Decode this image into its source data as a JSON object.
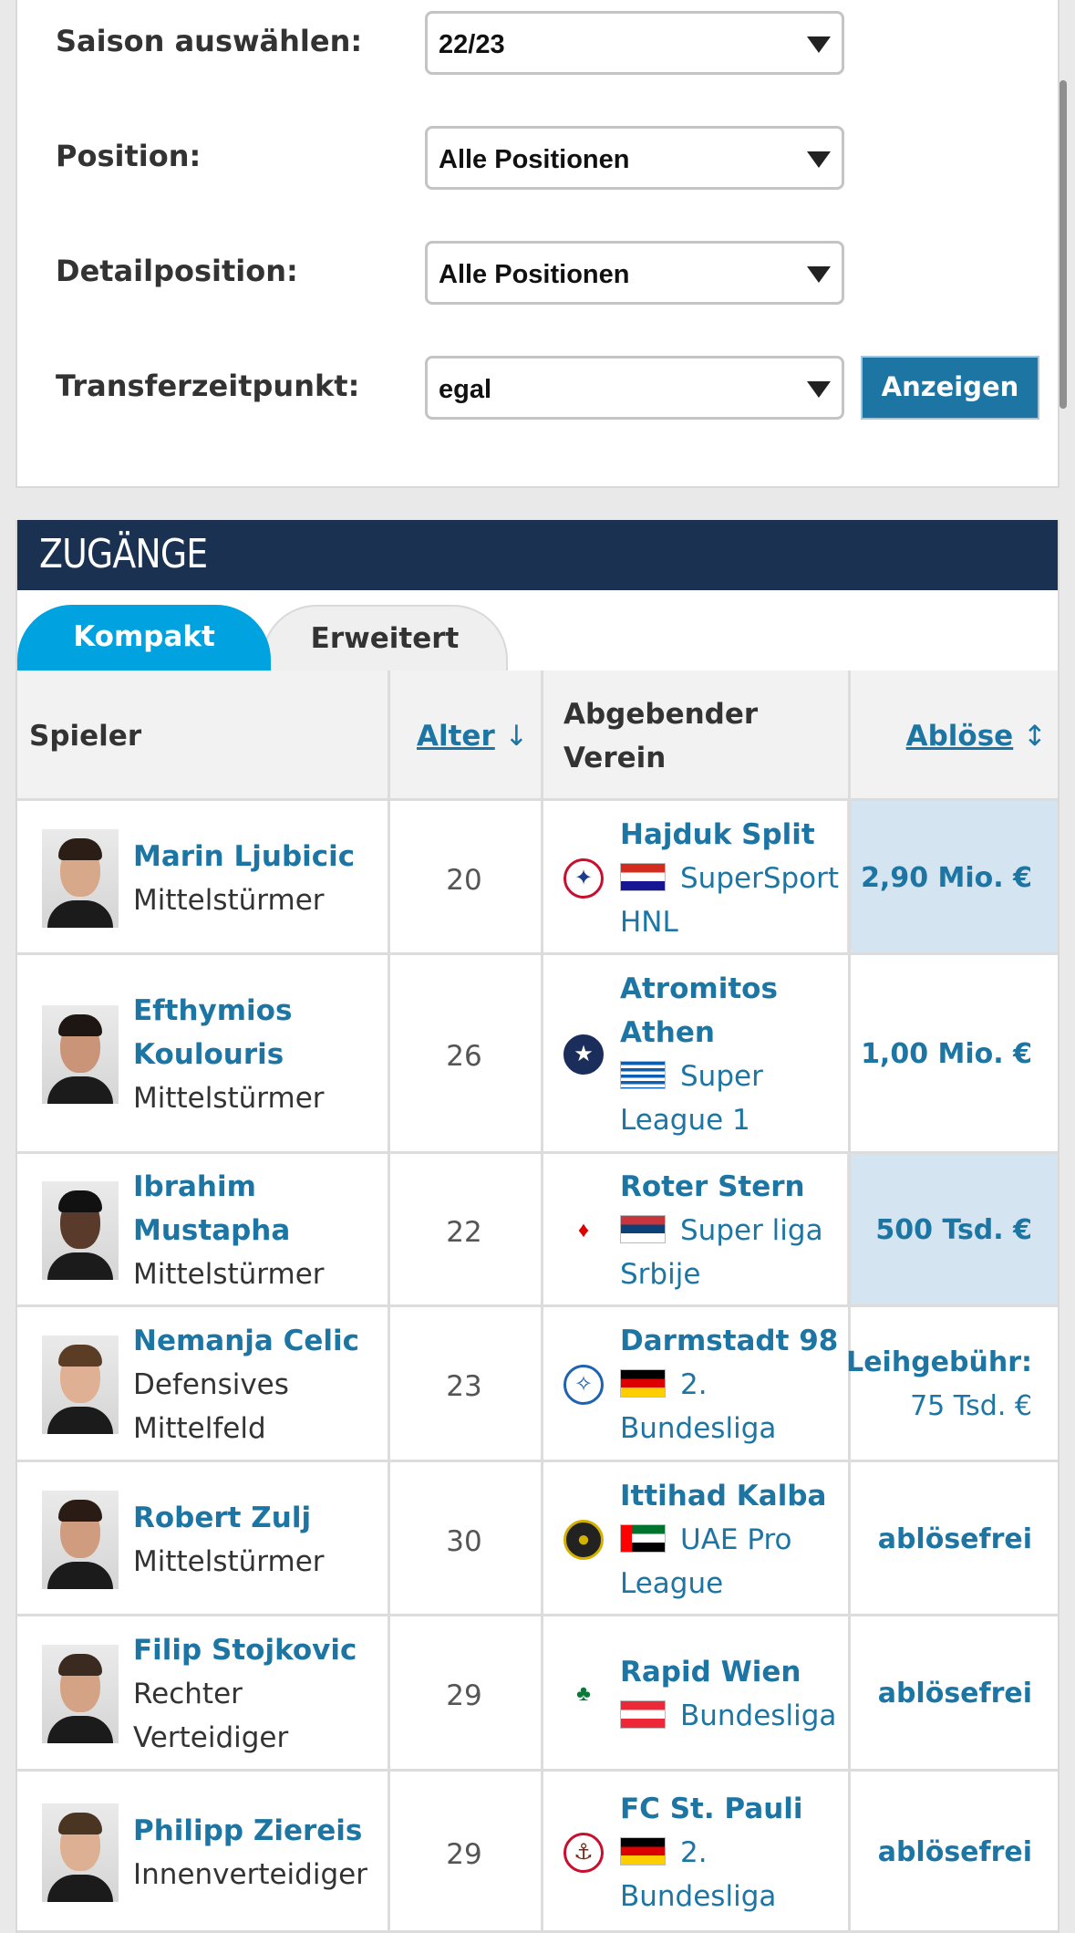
{
  "filters": {
    "season": {
      "label": "Saison auswählen:",
      "value": "22/23"
    },
    "position": {
      "label": "Position:",
      "value": "Alle Positionen"
    },
    "detail_position": {
      "label": "Detailposition:",
      "value": "Alle Positionen"
    },
    "transfer_time": {
      "label": "Transferzeitpunkt:",
      "value": "egal"
    },
    "show_button": "Anzeigen"
  },
  "transfers": {
    "title": "ZUGÄNGE",
    "tabs": [
      {
        "label": "Kompakt",
        "active": true
      },
      {
        "label": "Erweitert",
        "active": false
      }
    ],
    "columns": {
      "player": "Spieler",
      "age": "Alter",
      "age_sort": "↓",
      "club_line1": "Abgebender",
      "club_line2": "Verein",
      "fee": "Ablöse",
      "fee_sort": "↕"
    },
    "rows": [
      {
        "name": [
          "Marin Ljubicic"
        ],
        "position": [
          "Mittelstürmer"
        ],
        "age": "20",
        "club": [
          "Hajduk Split"
        ],
        "league": [
          "SuperSport",
          "HNL"
        ],
        "flag": "croatia",
        "fee": [
          "2,90 Mio. €"
        ],
        "highlight": true
      },
      {
        "name": [
          "Efthymios",
          "Koulouris"
        ],
        "position": [
          "Mittelstürmer"
        ],
        "age": "26",
        "club": [
          "Atromitos",
          "Athen"
        ],
        "league": [
          "Super",
          "League 1"
        ],
        "flag": "greece",
        "fee": [
          "1,00 Mio. €"
        ],
        "highlight": false
      },
      {
        "name": [
          "Ibrahim",
          "Mustapha"
        ],
        "position": [
          "Mittelstürmer"
        ],
        "age": "22",
        "club": [
          "Roter Stern"
        ],
        "league": [
          "Super liga",
          "Srbije"
        ],
        "flag": "serbia",
        "fee": [
          "500 Tsd. €"
        ],
        "highlight": true
      },
      {
        "name": [
          "Nemanja Celic"
        ],
        "position": [
          "Defensives",
          "Mittelfeld"
        ],
        "age": "23",
        "club": [
          "Darmstadt 98"
        ],
        "league": [
          "2.",
          "Bundesliga"
        ],
        "flag": "germany",
        "fee": [
          "Leihgebühr:",
          "75 Tsd. €"
        ],
        "highlight": false
      },
      {
        "name": [
          "Robert Zulj"
        ],
        "position": [
          "Mittelstürmer"
        ],
        "age": "30",
        "club": [
          "Ittihad Kalba"
        ],
        "league": [
          "UAE Pro",
          "League"
        ],
        "flag": "uae",
        "fee": [
          "ablösefrei"
        ],
        "highlight": false
      },
      {
        "name": [
          "Filip Stojkovic"
        ],
        "position": [
          "Rechter",
          "Verteidiger"
        ],
        "age": "29",
        "club": [
          "Rapid Wien"
        ],
        "league": [
          "Bundesliga"
        ],
        "flag": "austria",
        "fee": [
          "ablösefrei"
        ],
        "highlight": false
      },
      {
        "name": [
          "Philipp Ziereis"
        ],
        "position": [
          "Innenverteidiger"
        ],
        "age": "29",
        "club": [
          "FC St. Pauli"
        ],
        "league": [
          "2.",
          "Bundesliga"
        ],
        "flag": "germany",
        "fee": [
          "ablösefrei"
        ],
        "highlight": false
      }
    ]
  },
  "colors": {
    "link": "#1d75a3",
    "header_bg": "#1a3151",
    "tab_active": "#00a3e0",
    "fee_highlight": "#d4e4f0",
    "button_bg": "#1d75a3"
  }
}
